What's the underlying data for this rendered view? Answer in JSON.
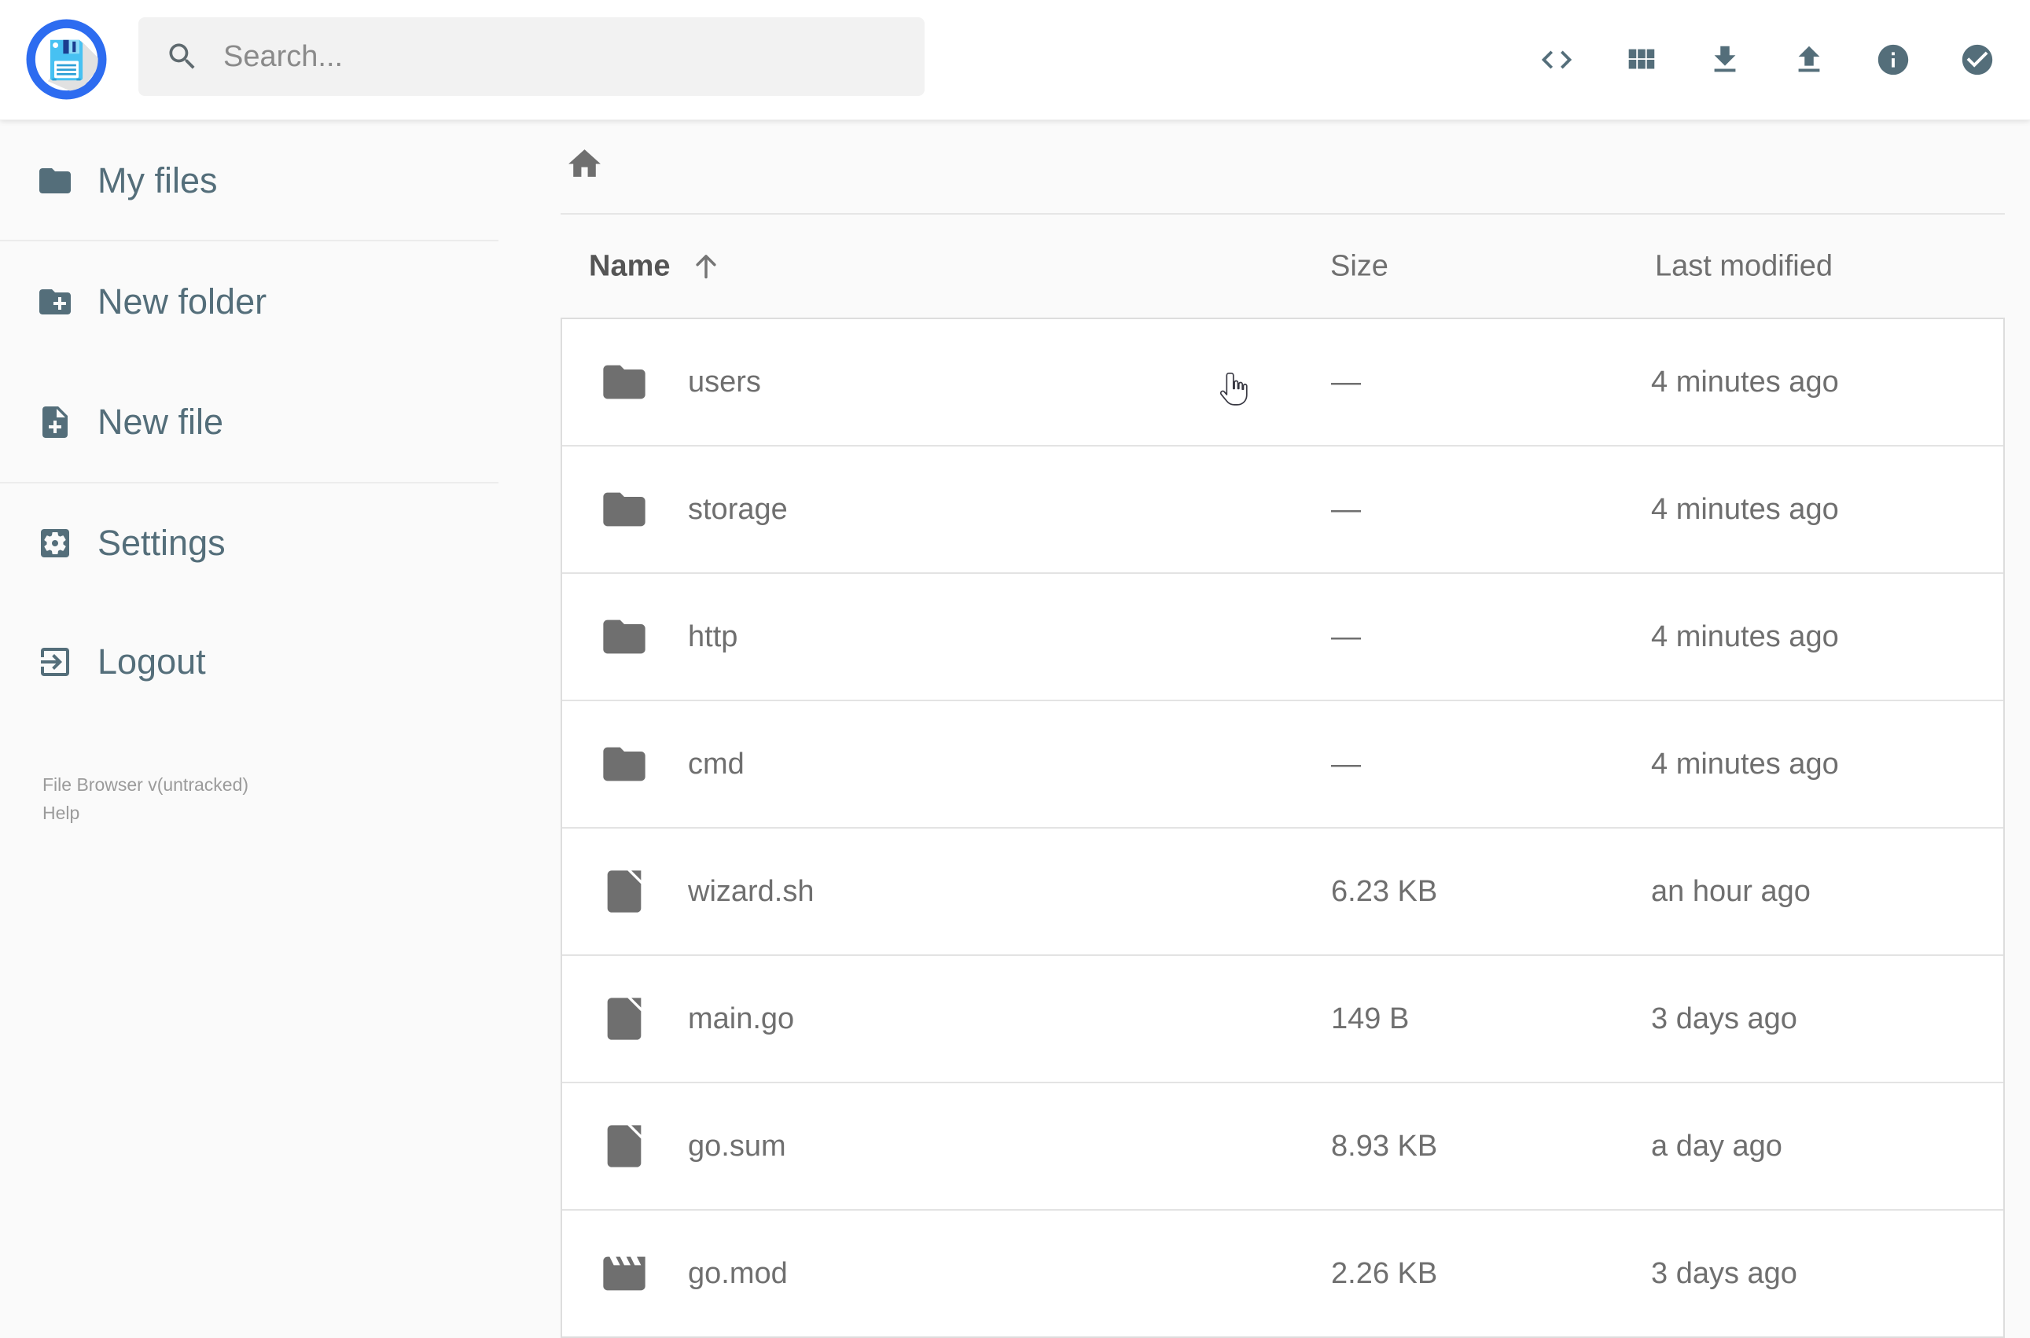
{
  "header": {
    "search": {
      "placeholder": "Search...",
      "icon": "search"
    },
    "actions": [
      {
        "name": "raw-view",
        "icon": "code"
      },
      {
        "name": "switch-view",
        "icon": "grid"
      },
      {
        "name": "download",
        "icon": "download"
      },
      {
        "name": "upload",
        "icon": "upload"
      },
      {
        "name": "info",
        "icon": "info"
      },
      {
        "name": "select-multiple",
        "icon": "check"
      }
    ]
  },
  "sidebar": {
    "items": [
      {
        "label": "My files",
        "icon": "folder"
      },
      {
        "label": "New folder",
        "icon": "new-folder"
      },
      {
        "label": "New file",
        "icon": "new-file"
      },
      {
        "label": "Settings",
        "icon": "settings"
      },
      {
        "label": "Logout",
        "icon": "logout"
      }
    ],
    "footer": {
      "version": "File Browser v(untracked)",
      "help": "Help"
    }
  },
  "breadcrumb": {
    "root_icon": "home"
  },
  "listing": {
    "columns": {
      "name": "Name",
      "size": "Size",
      "modified": "Last modified"
    },
    "sort": {
      "column": "name",
      "direction": "ascending"
    },
    "items": [
      {
        "name": "users",
        "type": "folder",
        "icon": "folder",
        "size": "—",
        "modified": "4 minutes ago"
      },
      {
        "name": "storage",
        "type": "folder",
        "icon": "folder",
        "size": "—",
        "modified": "4 minutes ago"
      },
      {
        "name": "http",
        "type": "folder",
        "icon": "folder",
        "size": "—",
        "modified": "4 minutes ago"
      },
      {
        "name": "cmd",
        "type": "folder",
        "icon": "folder",
        "size": "—",
        "modified": "4 minutes ago"
      },
      {
        "name": "wizard.sh",
        "type": "file",
        "icon": "file",
        "size": "6.23 KB",
        "modified": "an hour ago"
      },
      {
        "name": "main.go",
        "type": "file",
        "icon": "file",
        "size": "149 B",
        "modified": "3 days ago"
      },
      {
        "name": "go.sum",
        "type": "file",
        "icon": "file",
        "size": "8.93 KB",
        "modified": "a day ago"
      },
      {
        "name": "go.mod",
        "type": "file",
        "icon": "movie",
        "size": "2.26 KB",
        "modified": "3 days ago"
      }
    ]
  },
  "colors": {
    "accent_slate": "#546e7a",
    "listing_text": "#6f6f6f",
    "page_background": "#fafafa",
    "logo_ring_blue": "#2d6cf0",
    "logo_floppy_blue": "#47c1f2"
  }
}
